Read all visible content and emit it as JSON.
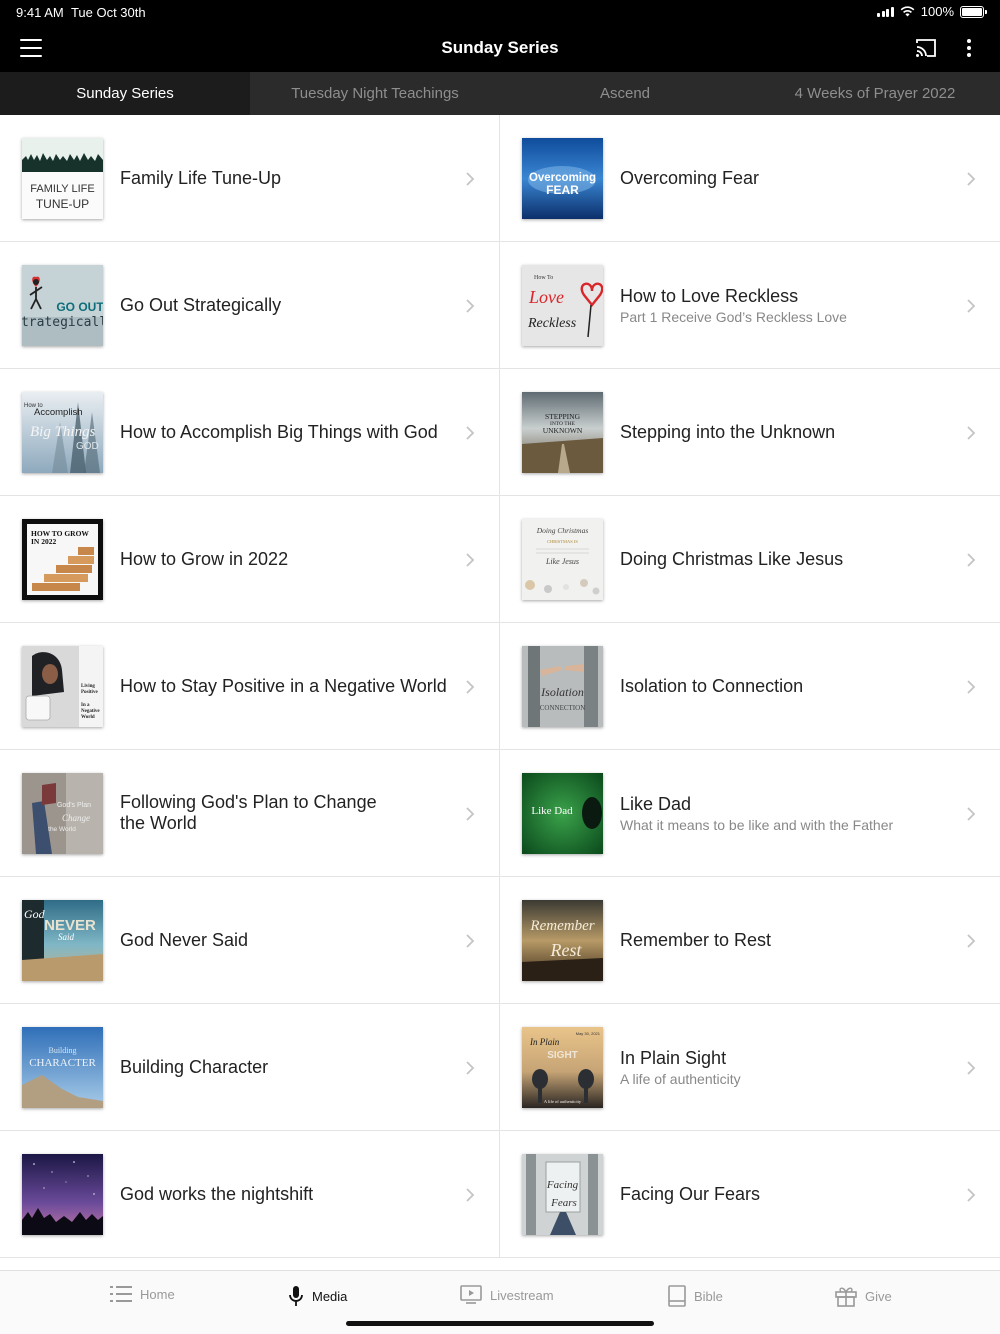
{
  "status": {
    "time": "9:41 AM",
    "date": "Tue Oct 30th",
    "battery": "100%"
  },
  "nav": {
    "title": "Sunday Series"
  },
  "tabs": [
    {
      "label": "Sunday Series",
      "active": true
    },
    {
      "label": "Tuesday Night Teachings",
      "active": false
    },
    {
      "label": "Ascend",
      "active": false
    },
    {
      "label": "4 Weeks of Prayer 2022",
      "active": false
    }
  ],
  "series": [
    {
      "title": "Family Life Tune-Up",
      "subtitle": "",
      "thumb_text": [
        "FAMILY LIFE",
        "TUNE-UP"
      ]
    },
    {
      "title": "Overcoming Fear",
      "subtitle": "",
      "thumb_text": [
        "Overcoming",
        "FEAR"
      ]
    },
    {
      "title": "Go Out Strategically",
      "subtitle": "",
      "thumb_text": [
        "GO OUT",
        "strategically"
      ]
    },
    {
      "title": "How to Love Reckless",
      "subtitle": "Part 1 Receive God’s Reckless Love",
      "thumb_text": [
        "How To",
        "Love",
        "Reckless"
      ]
    },
    {
      "title": "How to Accomplish Big Things with God",
      "subtitle": "",
      "thumb_text": [
        "How to",
        "Accomplish",
        "Big Things",
        "GOD"
      ]
    },
    {
      "title": "Stepping into the Unknown",
      "subtitle": "",
      "thumb_text": [
        "STEPPING",
        "INTO THE",
        "UNKNOWN"
      ]
    },
    {
      "title": "How to Grow in 2022",
      "subtitle": "",
      "thumb_text": [
        "HOW TO GROW",
        "IN 2022"
      ]
    },
    {
      "title": "Doing Christmas Like Jesus",
      "subtitle": "",
      "thumb_text": [
        "Doing Christmas",
        "CHRISTMAS IS",
        "Like Jesus"
      ]
    },
    {
      "title": "How to Stay Positive in a Negative World",
      "subtitle": "",
      "thumb_text": [
        "Living",
        "Positive",
        "In a",
        "Negative",
        "World"
      ]
    },
    {
      "title": "Isolation to Connection",
      "subtitle": "",
      "thumb_text": [
        "Isolation",
        "CONNECTION"
      ]
    },
    {
      "title": "Following God's Plan to Change the World",
      "subtitle": "",
      "thumb_text": [
        "God's Plan",
        "Change",
        "the World"
      ]
    },
    {
      "title": "Like Dad",
      "subtitle": "What it means to be like and with the Father",
      "thumb_text": [
        "Like Dad"
      ]
    },
    {
      "title": "God Never Said",
      "subtitle": "",
      "thumb_text": [
        "God",
        "NEVER",
        "Said"
      ]
    },
    {
      "title": "Remember to Rest",
      "subtitle": "",
      "thumb_text": [
        "Remember",
        "Rest"
      ]
    },
    {
      "title": "Building Character",
      "subtitle": "",
      "thumb_text": [
        "Building",
        "CHARACTER"
      ]
    },
    {
      "title": "In Plain Sight",
      "subtitle": "A life of authenticity",
      "thumb_text": [
        "May 30, 2021",
        "In Plain",
        "SIGHT",
        "A life of authenticity"
      ]
    },
    {
      "title": "God works the nightshift",
      "subtitle": "",
      "thumb_text": []
    },
    {
      "title": "Facing Our Fears",
      "subtitle": "",
      "thumb_text": [
        "Facing",
        "Fears"
      ]
    }
  ],
  "bottom_nav": [
    {
      "label": "Home",
      "icon": "list-icon",
      "active": false
    },
    {
      "label": "Media",
      "icon": "microphone-icon",
      "active": true
    },
    {
      "label": "Livestream",
      "icon": "play-screen-icon",
      "active": false
    },
    {
      "label": "Bible",
      "icon": "book-icon",
      "active": false
    },
    {
      "label": "Give",
      "icon": "gift-icon",
      "active": false
    }
  ]
}
